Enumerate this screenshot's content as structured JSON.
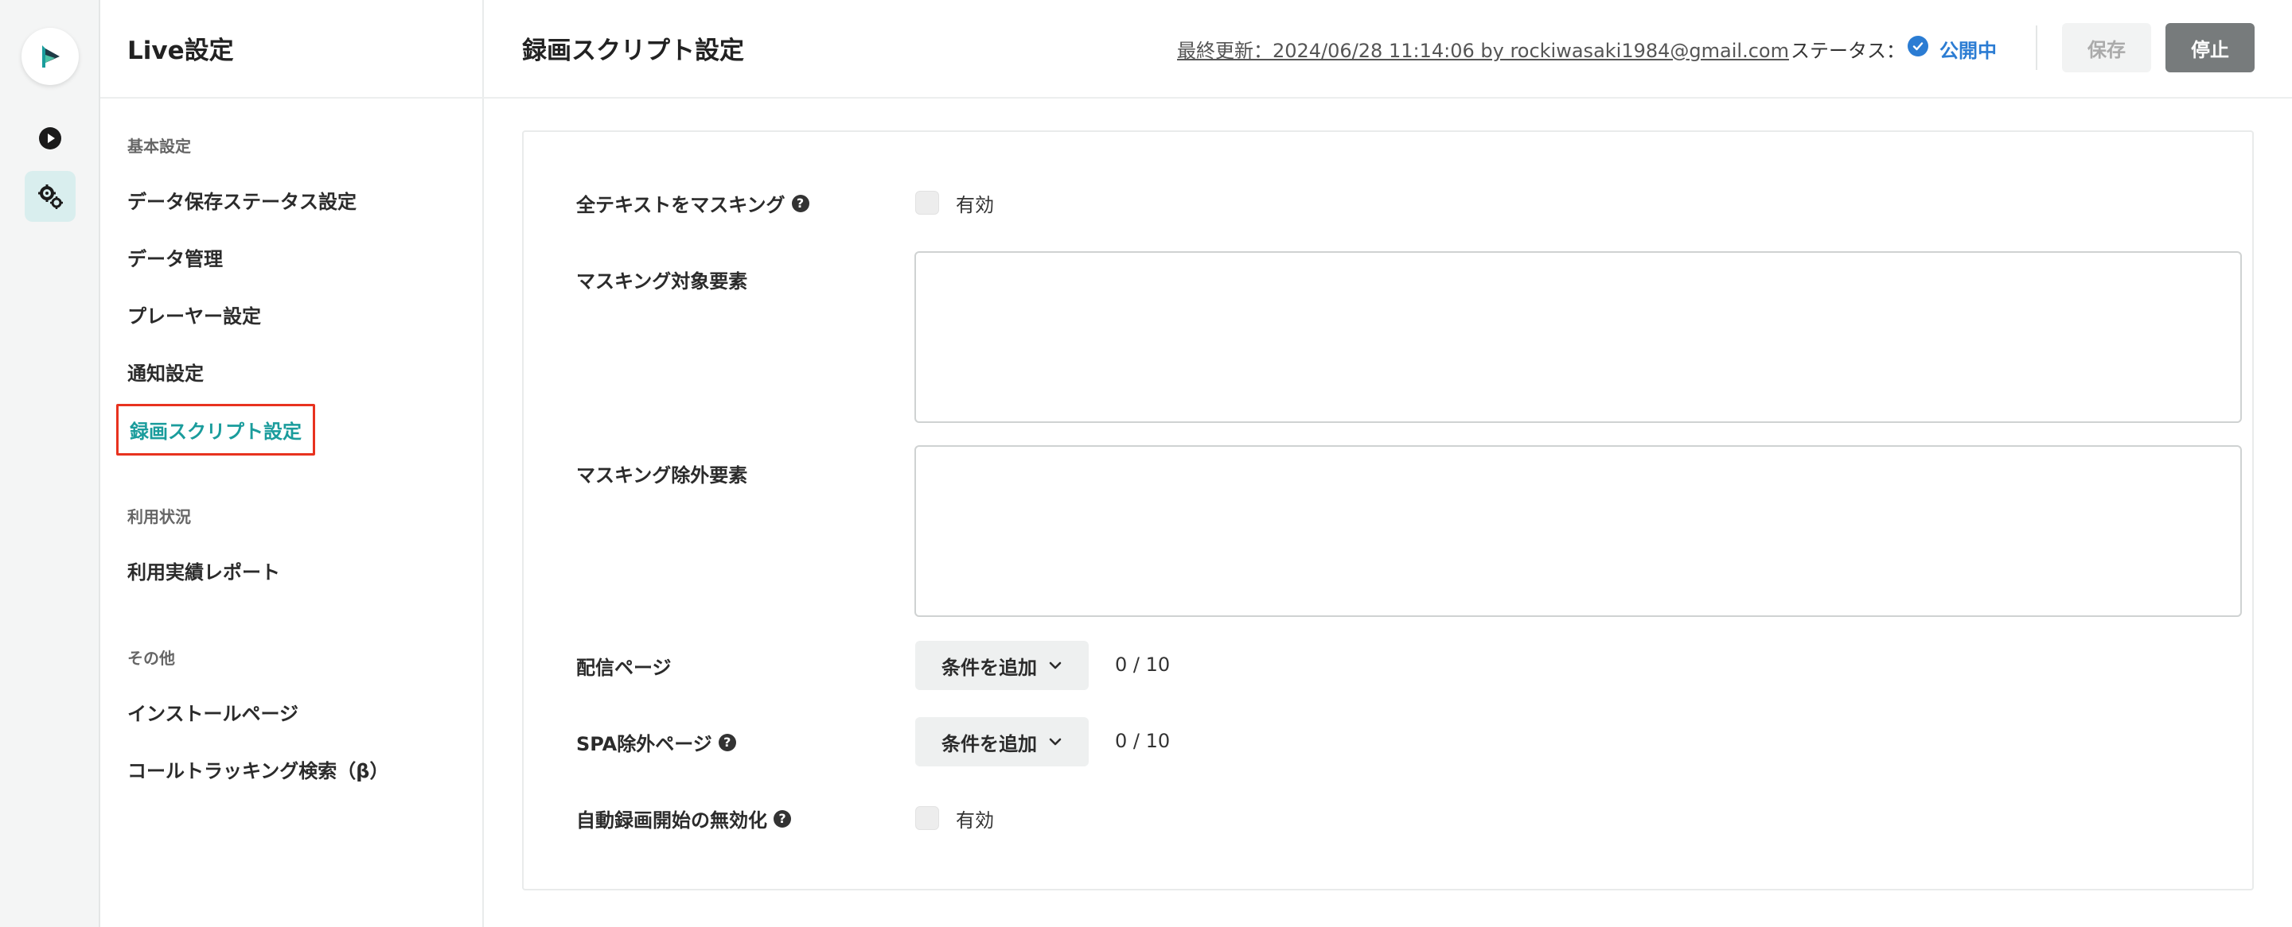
{
  "nav": {
    "title": "Live設定",
    "sections": [
      {
        "label": "基本設定",
        "items": [
          "データ保存ステータス設定",
          "データ管理",
          "プレーヤー設定",
          "通知設定",
          "録画スクリプト設定"
        ]
      },
      {
        "label": "利用状況",
        "items": [
          "利用実績レポート"
        ]
      },
      {
        "label": "その他",
        "items": [
          "インストールページ",
          "コールトラッキング検索（β）"
        ]
      }
    ],
    "active_item": "録画スクリプト設定"
  },
  "header": {
    "title": "録画スクリプト設定",
    "last_updated": "最終更新：2024/06/28 11:14:06 by rockiwasaki1984@gmail.com",
    "status_label": "ステータス：",
    "status_value": "公開中",
    "save_label": "保存",
    "stop_label": "停止"
  },
  "form": {
    "mask_all_text": {
      "label": "全テキストをマスキング",
      "checkbox_label": "有効",
      "checked": false
    },
    "mask_targets": {
      "label": "マスキング対象要素",
      "value": ""
    },
    "mask_excludes": {
      "label": "マスキング除外要素",
      "value": ""
    },
    "delivery_pages": {
      "label": "配信ページ",
      "button_label": "条件を追加",
      "count": "0 / 10"
    },
    "spa_excluded_pages": {
      "label": "SPA除外ページ",
      "button_label": "条件を追加",
      "count": "0 / 10"
    },
    "disable_auto_record": {
      "label": "自動録画開始の無効化",
      "checkbox_label": "有効",
      "checked": false
    }
  },
  "colors": {
    "accent": "#1a9c9c",
    "status_blue": "#2b7cd3",
    "highlight_red": "#e8321f",
    "stop_button": "#777b7c"
  },
  "icons": {
    "logo": "brand-logo-icon",
    "rail_play": "play-circle-icon",
    "rail_settings": "gears-icon",
    "status": "check-circle-icon",
    "help": "question-circle-icon",
    "dropdown": "chevron-down-icon"
  }
}
